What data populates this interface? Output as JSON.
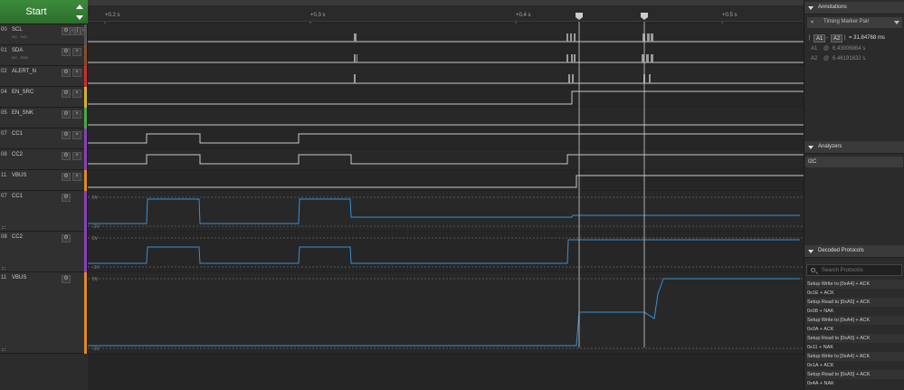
{
  "toolbar": {
    "start_label": "Start"
  },
  "channels": [
    {
      "num": "00",
      "name": "SCL",
      "sub": "I2C - SCL",
      "color": "#555555"
    },
    {
      "num": "01",
      "name": "SDA",
      "sub": "I2C - SDA",
      "color": "#8b4a2b"
    },
    {
      "num": "02",
      "name": "ALERT_N",
      "sub": "",
      "color": "#c8302b"
    },
    {
      "num": "04",
      "name": "EN_SRC",
      "sub": "",
      "color": "#d4b428"
    },
    {
      "num": "05",
      "name": "EN_SNK",
      "sub": "",
      "color": "#4aa84a"
    },
    {
      "num": "07",
      "name": "CC1",
      "sub": "",
      "color": "#8b3fb8"
    },
    {
      "num": "08",
      "name": "CC2",
      "sub": "",
      "color": "#8b3fb8"
    },
    {
      "num": "11",
      "name": "VBUS",
      "sub": "",
      "color": "#e08a22"
    },
    {
      "num": "07",
      "name": "CC1",
      "sub": "",
      "color": "#8b3fb8"
    },
    {
      "num": "08",
      "name": "CC2",
      "sub": "",
      "color": "#8b3fb8"
    },
    {
      "num": "11",
      "name": "VBUS",
      "sub": "",
      "color": "#e08a22"
    }
  ],
  "timeline": {
    "ticks": [
      "+0.2 s",
      "+0.3 s",
      "+0.4 s",
      "+0.5 s"
    ]
  },
  "analog_labels": {
    "cc1_top": "5V",
    "cc1_bot": "-1V",
    "cc2_top": "5V",
    "cc2_bot": "-1V",
    "vbus_top": "5V",
    "vbus_bot": "-1V"
  },
  "annotations": {
    "title": "Annotations",
    "pair_label": "Timing Marker Pair",
    "a1_box": "A1",
    "a2_box": "A2",
    "delta": "= 31.84768 ms",
    "a1_label": "A1",
    "a1_at": "@",
    "a1_value": "6.43006864 s",
    "a2_label": "A2",
    "a2_at": "@",
    "a2_value": "6.46191632 s"
  },
  "analyzers": {
    "title": "Analyzers",
    "items": [
      "I2C"
    ]
  },
  "decoded": {
    "title": "Decoded Protocols",
    "search_placeholder": "Search Protocols",
    "rows": [
      "Setup Write to [0xA4] + ACK",
      "0x1E + ACK",
      "Setup Read to [0xA5] + ACK",
      "0x08 + NAK",
      "Setup Write to [0xA4] + ACK",
      "0x0A + ACK",
      "Setup Read to [0xA5] + ACK",
      "0x11 + NAK",
      "Setup Write to [0xA4] + ACK",
      "0x1A + ACK",
      "Setup Read to [0xA5] + ACK",
      "0x4A + NAK"
    ]
  },
  "colors": {
    "accent_green": "#3d8b3d",
    "digital_trace": "#c8c8c8",
    "analog_trace": "#3a8fd6",
    "marker_line": "#d0d0d0"
  }
}
